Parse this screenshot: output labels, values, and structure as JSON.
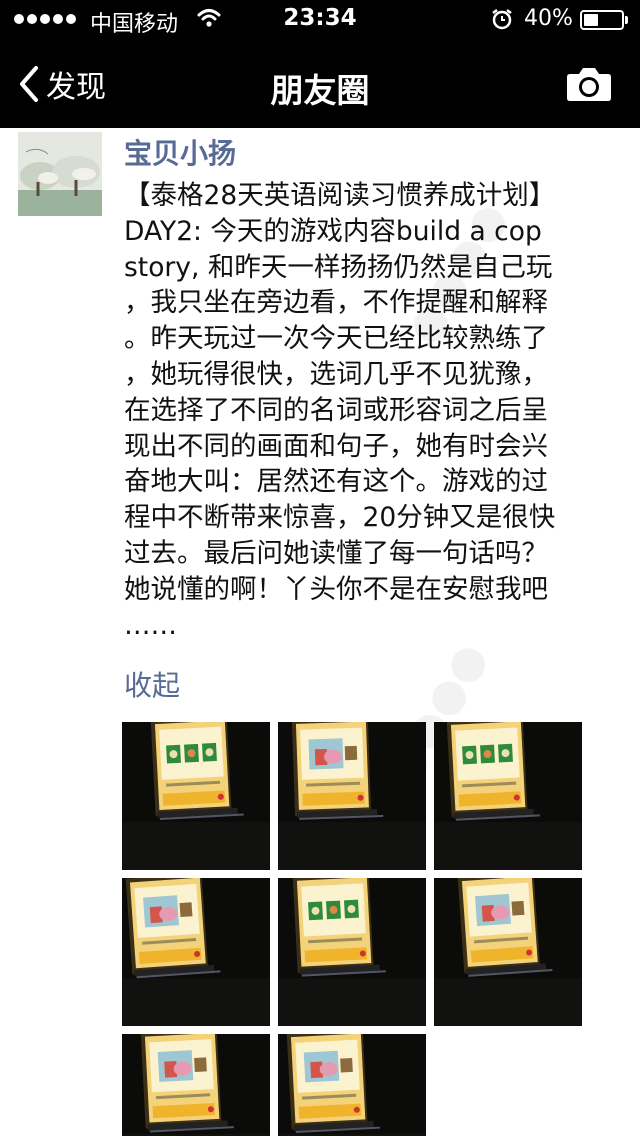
{
  "status_bar": {
    "carrier": "中国移动",
    "time": "23:34",
    "battery_percent": "40%",
    "battery_level": 0.4
  },
  "nav": {
    "back_label": "发现",
    "title": "朋友圈",
    "back_icon": "chevron-left-icon",
    "camera_icon": "camera-icon"
  },
  "post": {
    "username": "宝贝小扬",
    "text_lines": [
      "【泰格28天英语阅读习惯养成计划】",
      "DAY2: 今天的游戏内容build a cop",
      "story, 和昨天一样扬扬仍然是自己玩",
      "，我只坐在旁边看，不作提醒和解释",
      "。昨天玩过一次今天已经比较熟练了",
      "，她玩得很快，选词几乎不见犹豫，",
      "在选择了不同的名词或形容词之后呈",
      "现出不同的画面和句子，她有时会兴",
      "奋地大叫：居然还有这个。游戏的过",
      "程中不断带来惊喜，20分钟又是很快",
      "过去。最后问她读懂了每一句话吗？",
      "她说懂的啊！丫头你不是在安慰我吧",
      "……"
    ],
    "collapse_label": "收起",
    "photo_count": 8
  },
  "colors": {
    "link_blue": "#576b95",
    "bar_black": "#000000",
    "text": "#111111"
  }
}
